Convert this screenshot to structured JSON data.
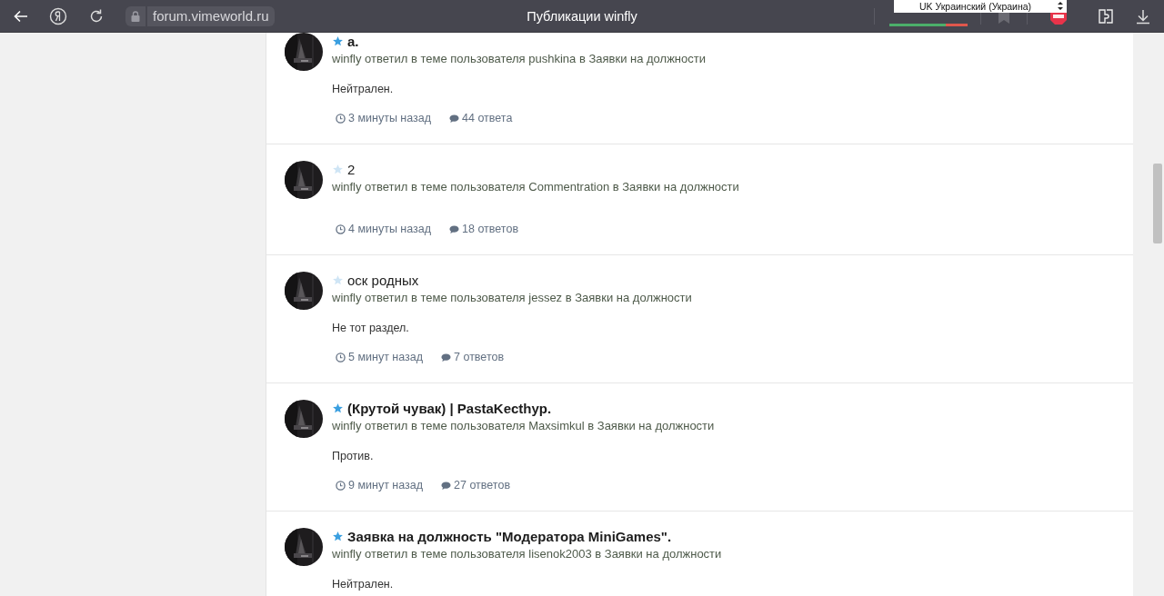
{
  "browser": {
    "address": "forum.vimeworld.ru",
    "title": "Публикации winfly",
    "language_select": "UK Украинский (Украина)"
  },
  "posts": [
    {
      "title": "a.",
      "unread": true,
      "meta": "winfly ответил в теме пользователя pushkina в Заявки на должности",
      "excerpt": "Нейтрален.",
      "time": "3 минуты назад",
      "replies": "44 ответа"
    },
    {
      "title": "2",
      "unread": false,
      "meta": "winfly ответил в теме пользователя Commentration в Заявки на должности",
      "time": "4 минуты назад",
      "replies": "18 ответов"
    },
    {
      "title": "оск родных",
      "unread": false,
      "meta": "winfly ответил в теме пользователя jessez в Заявки на должности",
      "excerpt": "Не тот раздел.",
      "time": "5 минут назад",
      "replies": "7 ответов"
    },
    {
      "title": "(Крутой чувак) | PastaKecthyp.",
      "unread": true,
      "meta": "winfly ответил в теме пользователя Maxsimkul в Заявки на должности",
      "excerpt": "Против.",
      "time": "9 минут назад",
      "replies": "27 ответов"
    },
    {
      "title": "Заявка на должность \"Модератора MiniGames\".",
      "unread": true,
      "meta": "winfly ответил в теме пользователя lisenok2003 в Заявки на должности",
      "excerpt": "Нейтрален."
    }
  ]
}
